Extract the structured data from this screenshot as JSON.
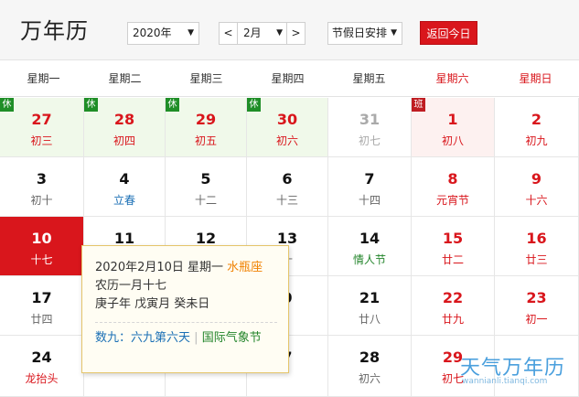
{
  "app": {
    "title": "万年历"
  },
  "controls": {
    "year_select": "2020年",
    "month_prev": "<",
    "month_select": "2月",
    "month_next": ">",
    "holiday_select": "节假日安排",
    "today_button": "返回今日",
    "dropdown_arrow": "▼"
  },
  "weekdays": [
    "星期一",
    "星期二",
    "星期三",
    "星期四",
    "星期五",
    "星期六",
    "星期日"
  ],
  "tags": {
    "rest": "休",
    "work": "班"
  },
  "days": [
    {
      "num": "27",
      "lunar": "初三",
      "kind": "hol red",
      "tag": "rest"
    },
    {
      "num": "28",
      "lunar": "初四",
      "kind": "hol red",
      "tag": "rest"
    },
    {
      "num": "29",
      "lunar": "初五",
      "kind": "hol red",
      "tag": "rest"
    },
    {
      "num": "30",
      "lunar": "初六",
      "kind": "hol red",
      "tag": "rest"
    },
    {
      "num": "31",
      "lunar": "初七",
      "kind": "gray"
    },
    {
      "num": "1",
      "lunar": "初八",
      "kind": "wrk red",
      "tag": "work"
    },
    {
      "num": "2",
      "lunar": "初九",
      "kind": "red"
    },
    {
      "num": "3",
      "lunar": "初十",
      "kind": ""
    },
    {
      "num": "4",
      "lunar": "立春",
      "kind": "",
      "lunar_class": "fest-blue"
    },
    {
      "num": "5",
      "lunar": "十二",
      "kind": ""
    },
    {
      "num": "6",
      "lunar": "十三",
      "kind": ""
    },
    {
      "num": "7",
      "lunar": "十四",
      "kind": ""
    },
    {
      "num": "8",
      "lunar": "元宵节",
      "kind": "red",
      "lunar_class": "fest-red"
    },
    {
      "num": "9",
      "lunar": "十六",
      "kind": "red"
    },
    {
      "num": "10",
      "lunar": "十七",
      "kind": "today"
    },
    {
      "num": "11",
      "lunar": "",
      "kind": ""
    },
    {
      "num": "12",
      "lunar": "",
      "kind": ""
    },
    {
      "num": "13",
      "lunar": "十",
      "kind": ""
    },
    {
      "num": "14",
      "lunar": "情人节",
      "kind": "",
      "lunar_class": "fest-green"
    },
    {
      "num": "15",
      "lunar": "廿二",
      "kind": "red"
    },
    {
      "num": "16",
      "lunar": "廿三",
      "kind": "red"
    },
    {
      "num": "17",
      "lunar": "廿四",
      "kind": ""
    },
    {
      "num": "",
      "lunar": "",
      "kind": ""
    },
    {
      "num": "",
      "lunar": "",
      "kind": ""
    },
    {
      "num": "0",
      "lunar": "",
      "kind": ""
    },
    {
      "num": "21",
      "lunar": "廿八",
      "kind": ""
    },
    {
      "num": "22",
      "lunar": "廿九",
      "kind": "red"
    },
    {
      "num": "23",
      "lunar": "初一",
      "kind": "red"
    },
    {
      "num": "24",
      "lunar": "龙抬头",
      "kind": "",
      "lunar_class": "fest-red"
    },
    {
      "num": "",
      "lunar": "",
      "kind": ""
    },
    {
      "num": "",
      "lunar": "",
      "kind": ""
    },
    {
      "num": "7",
      "lunar": "",
      "kind": ""
    },
    {
      "num": "28",
      "lunar": "初六",
      "kind": ""
    },
    {
      "num": "29",
      "lunar": "初七",
      "kind": "red"
    },
    {
      "num": "",
      "lunar": "",
      "kind": "red"
    }
  ],
  "popup": {
    "date_line": "2020年2月10日 星期一",
    "zodiac": "水瓶座",
    "lunar_line": "农历一月十七",
    "ganzhi_line": "庚子年 戊寅月 癸未日",
    "shujiu": "数九：六九第六天",
    "separator": "|",
    "event": "国际气象节"
  },
  "watermark": {
    "text": "天气万年历",
    "url": "wannianli.tianqi.com"
  }
}
